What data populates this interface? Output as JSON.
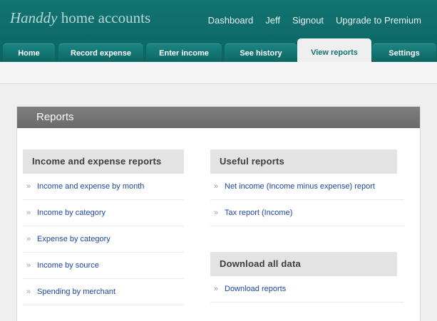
{
  "app": {
    "logo_brand": "Handdy",
    "logo_rest": "home accounts"
  },
  "topnav": [
    "Dashboard",
    "Jeff",
    "Signout",
    "Upgrade to Premium"
  ],
  "tabs": [
    {
      "label": "Home",
      "active": false
    },
    {
      "label": "Record expense",
      "active": false
    },
    {
      "label": "Enter income",
      "active": false
    },
    {
      "label": "See history",
      "active": false
    },
    {
      "label": "View reports",
      "active": true
    },
    {
      "label": "Settings",
      "active": false
    }
  ],
  "panel": {
    "title": "Reports"
  },
  "left": {
    "title": "Income and expense reports",
    "items": [
      "Income and expense by month",
      "Income by category",
      "Expense by category",
      "Income by source",
      "Spending by merchant"
    ]
  },
  "useful": {
    "title": "Useful reports",
    "items": [
      "Net income (Income minus expense) report",
      "Tax report (Income)"
    ]
  },
  "download": {
    "title": "Download all data",
    "items": [
      "Download reports"
    ]
  },
  "colors": {
    "header": "#137472",
    "link": "#1e46a0",
    "panel_header": "#757575"
  },
  "icons": {
    "bullet": "double-chevron-icon"
  }
}
